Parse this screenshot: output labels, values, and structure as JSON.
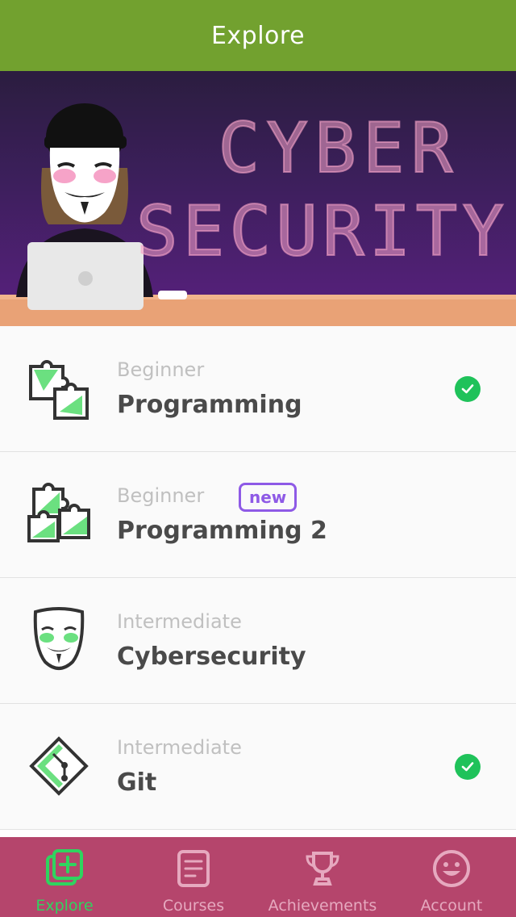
{
  "header": {
    "title": "Explore"
  },
  "banner": {
    "line1": "CYBER",
    "line2": "SECURITY"
  },
  "courses": [
    {
      "level": "Beginner",
      "title": "Programming",
      "badge": "",
      "completed": true,
      "icon": "puzzle-icon"
    },
    {
      "level": "Beginner",
      "title": "Programming 2",
      "badge": "new",
      "completed": false,
      "icon": "puzzle-icon"
    },
    {
      "level": "Intermediate",
      "title": "Cybersecurity",
      "badge": "",
      "completed": false,
      "icon": "mask-icon"
    },
    {
      "level": "Intermediate",
      "title": "Git",
      "badge": "",
      "completed": true,
      "icon": "git-icon"
    }
  ],
  "tabs": [
    {
      "label": "Explore",
      "icon": "explore-icon",
      "active": true
    },
    {
      "label": "Courses",
      "icon": "courses-icon",
      "active": false
    },
    {
      "label": "Achievements",
      "icon": "trophy-icon",
      "active": false
    },
    {
      "label": "Account",
      "icon": "smiley-icon",
      "active": false
    }
  ],
  "colors": {
    "header": "#72a12f",
    "tabbar": "#b5456c",
    "active_tab": "#2fd45f",
    "check": "#1fc25a",
    "badge": "#8e5ae6"
  }
}
